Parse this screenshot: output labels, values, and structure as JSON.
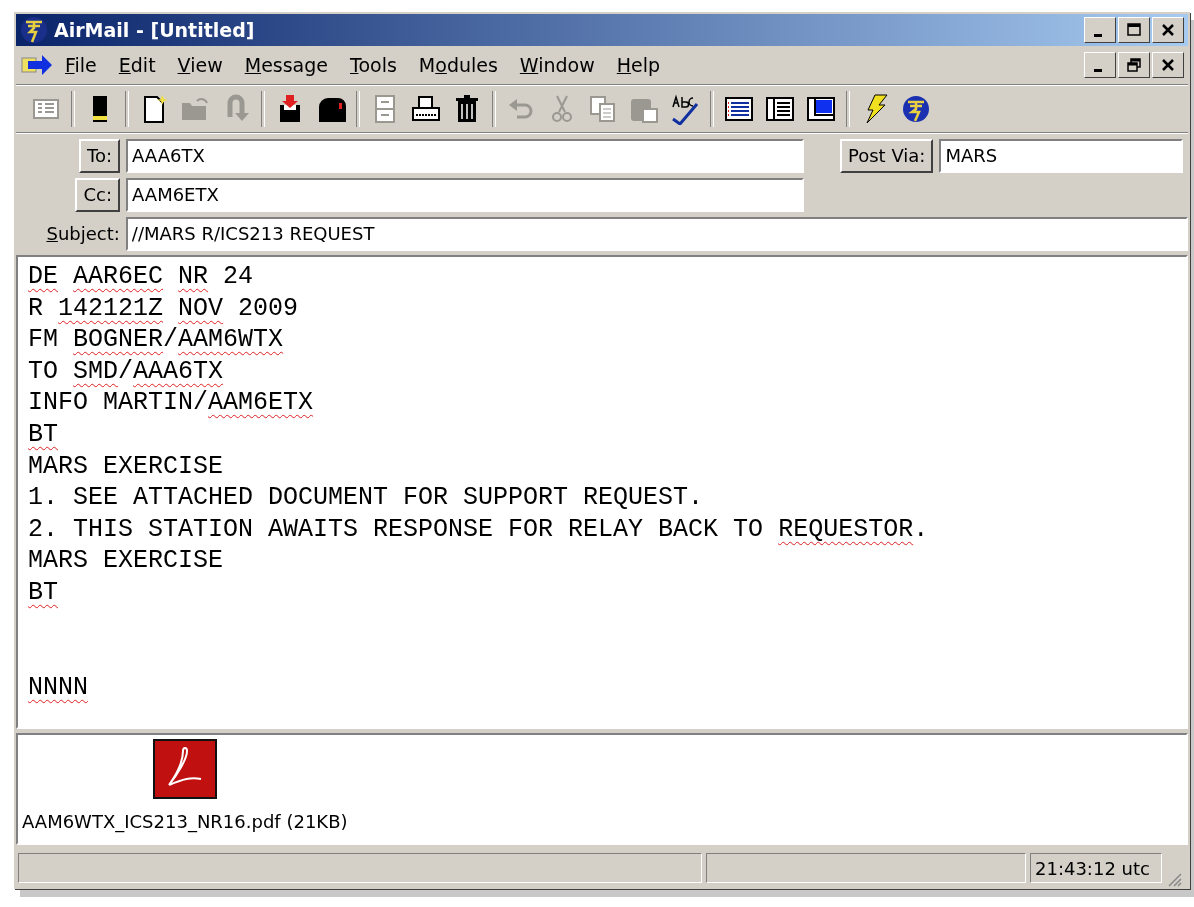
{
  "window": {
    "title": "AirMail - [Untitled]"
  },
  "menu": [
    {
      "key": "F",
      "after": "ile"
    },
    {
      "key": "E",
      "after": "dit"
    },
    {
      "key": "V",
      "after": "iew"
    },
    {
      "key": "M",
      "after": "essage"
    },
    {
      "key": "T",
      "after": "ools"
    },
    {
      "before": "M",
      "key": "o",
      "after": "dules"
    },
    {
      "key": "W",
      "after": "indow"
    },
    {
      "key": "H",
      "after": "elp"
    }
  ],
  "toolbar": [
    [
      {
        "kind": "list",
        "disabled": true
      }
    ],
    [
      {
        "kind": "book",
        "disabled": false
      }
    ],
    [
      {
        "kind": "new",
        "disabled": false
      },
      {
        "kind": "open",
        "disabled": true
      },
      {
        "kind": "reply",
        "disabled": true
      }
    ],
    [
      {
        "kind": "save",
        "disabled": false
      },
      {
        "kind": "mailbox",
        "disabled": false
      }
    ],
    [
      {
        "kind": "cabinet",
        "disabled": true
      },
      {
        "kind": "print",
        "disabled": false
      },
      {
        "kind": "trash",
        "disabled": false
      }
    ],
    [
      {
        "kind": "undo",
        "disabled": true
      },
      {
        "kind": "cut",
        "disabled": true
      },
      {
        "kind": "copy",
        "disabled": true
      },
      {
        "kind": "paste",
        "disabled": true
      },
      {
        "kind": "spell",
        "disabled": false
      }
    ],
    [
      {
        "kind": "columns",
        "disabled": false
      },
      {
        "kind": "lines",
        "disabled": false
      },
      {
        "kind": "pane",
        "disabled": false
      }
    ],
    [
      {
        "kind": "lightning",
        "disabled": false
      },
      {
        "kind": "globe",
        "disabled": false
      }
    ]
  ],
  "header": {
    "to": {
      "label": "To:",
      "value": "AAA6TX"
    },
    "cc": {
      "label": "Cc:",
      "value": "AAM6ETX"
    },
    "post_via": {
      "label": "Post Via:",
      "value": "MARS"
    },
    "subject": {
      "label": {
        "key": "S",
        "after": "ubject:"
      },
      "value": "//MARS R/ICS213 REQUEST"
    }
  },
  "body": [
    {
      "kind": "text",
      "segments": [
        {
          "text": "DE ",
          "misspelled": true
        },
        {
          "text": "AAR6EC ",
          "misspelled": true
        },
        {
          "text": "NR",
          "misspelled": true
        },
        {
          "text": " 24",
          "misspelled": false
        }
      ]
    },
    {
      "kind": "text",
      "segments": [
        {
          "text": "R ",
          "misspelled": false
        },
        {
          "text": "142121Z ",
          "misspelled": true
        },
        {
          "text": "NOV",
          "misspelled": true
        },
        {
          "text": " 2009",
          "misspelled": false
        }
      ]
    },
    {
      "kind": "text",
      "segments": [
        {
          "text": "FM ",
          "misspelled": false
        },
        {
          "text": "BOGNER",
          "misspelled": true
        },
        {
          "text": "/",
          "misspelled": false
        },
        {
          "text": "AAM6WTX",
          "misspelled": true
        }
      ]
    },
    {
      "kind": "text",
      "segments": [
        {
          "text": "TO ",
          "misspelled": false
        },
        {
          "text": "SMD",
          "misspelled": true
        },
        {
          "text": "/",
          "misspelled": false
        },
        {
          "text": "AAA6TX",
          "misspelled": true
        }
      ]
    },
    {
      "kind": "text",
      "segments": [
        {
          "text": "INFO MARTIN/",
          "misspelled": false
        },
        {
          "text": "AAM6ETX",
          "misspelled": true
        }
      ]
    },
    {
      "kind": "text",
      "segments": [
        {
          "text": "BT",
          "misspelled": true
        }
      ]
    },
    {
      "kind": "text",
      "segments": [
        {
          "text": "MARS EXERCISE",
          "misspelled": false
        }
      ]
    },
    {
      "kind": "text",
      "segments": [
        {
          "text": "1. SEE ATTACHED DOCUMENT FOR SUPPORT REQUEST.",
          "misspelled": false
        }
      ]
    },
    {
      "kind": "text",
      "segments": [
        {
          "text": "2. THIS STATION AWAITS RESPONSE FOR RELAY BACK TO ",
          "misspelled": false
        },
        {
          "text": "REQUESTOR",
          "misspelled": true
        },
        {
          "text": ".",
          "misspelled": false
        }
      ]
    },
    {
      "kind": "text",
      "segments": [
        {
          "text": "MARS EXERCISE",
          "misspelled": false
        }
      ]
    },
    {
      "kind": "text",
      "segments": [
        {
          "text": "BT",
          "misspelled": true
        }
      ]
    },
    {
      "kind": "blank"
    },
    {
      "kind": "blank"
    },
    {
      "kind": "text",
      "segments": [
        {
          "text": "NNNN",
          "misspelled": true
        }
      ]
    }
  ],
  "attachments": [
    {
      "name": "AAM6WTX_ICS213_NR16.pdf (21KB)"
    }
  ],
  "status_bar": {
    "time": "21:43:12 utc"
  }
}
